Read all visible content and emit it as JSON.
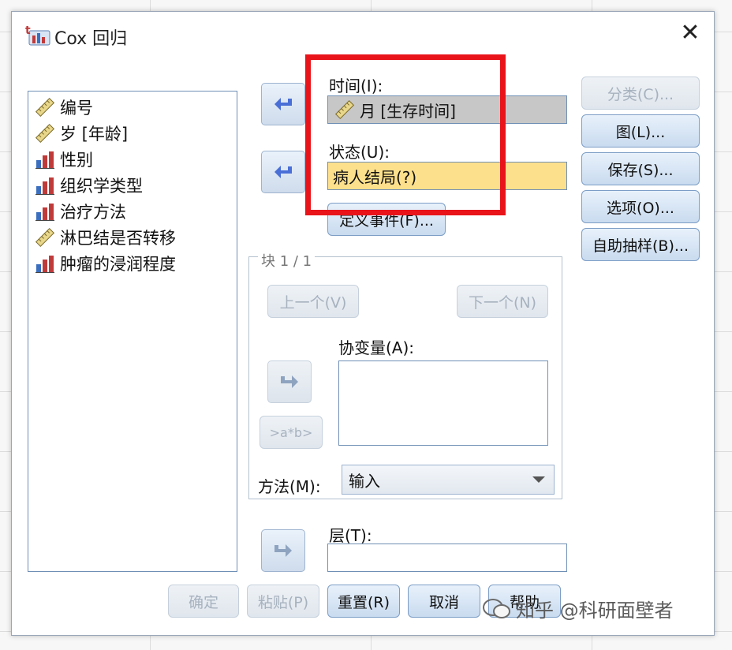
{
  "window": {
    "title": "Cox 回归",
    "close_glyph": "✕"
  },
  "variables": [
    {
      "label": "编号",
      "icon": "ruler-icon"
    },
    {
      "label": "岁 [年龄]",
      "icon": "ruler-icon"
    },
    {
      "label": "性别",
      "icon": "bar-chart-icon"
    },
    {
      "label": "组织学类型",
      "icon": "bar-chart-icon"
    },
    {
      "label": "治疗方法",
      "icon": "bar-chart-icon"
    },
    {
      "label": "淋巴结是否转移",
      "icon": "ruler-icon"
    },
    {
      "label": "肿瘤的浸润程度",
      "icon": "bar-chart-icon"
    }
  ],
  "time": {
    "label": "时间(I):",
    "value": "月 [生存时间]"
  },
  "status": {
    "label": "状态(U):",
    "value": "病人结局(?)"
  },
  "define_event_button": "定义事件(F)...",
  "block": {
    "title": "块 1 / 1",
    "prev_button": "上一个(V)",
    "next_button": "下一个(N)",
    "covariates_label": "协变量(A):",
    "interaction_button": ">a*b>",
    "method_label": "方法(M):",
    "method_value": "输入"
  },
  "strata": {
    "label": "层(T):",
    "value": ""
  },
  "side_buttons": {
    "categorical": "分类(C)...",
    "plots": "图(L)...",
    "save": "保存(S)...",
    "options": "选项(O)...",
    "bootstrap": "自助抽样(B)..."
  },
  "bottom_buttons": {
    "ok": "确定",
    "paste": "粘贴(P)",
    "reset": "重置(R)",
    "cancel": "取消",
    "help": "帮助"
  },
  "watermark": "知乎 @科研面壁者",
  "colors": {
    "highlight_box": "#e8141a",
    "status_fill": "#fde08c",
    "time_fill": "#c7c7c7",
    "accent": "#4a6fd6"
  }
}
